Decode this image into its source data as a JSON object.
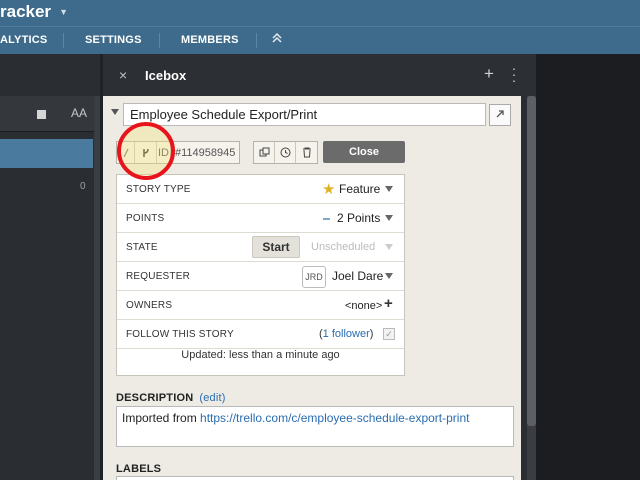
{
  "header": {
    "app_name": "racker",
    "nav": [
      {
        "label": "ALYTICS"
      },
      {
        "label": "SETTINGS"
      },
      {
        "label": "MEMBERS"
      }
    ],
    "collapse_icon": "double-chevron-up-icon"
  },
  "left_panel": {
    "zero_count": "0",
    "font_size_label": "AA"
  },
  "panel": {
    "title": "Icebox",
    "close_glyph": "×",
    "add_glyph": "+"
  },
  "story": {
    "title": "Employee Schedule Export/Print",
    "id_label": "ID",
    "id_value": "#114958945",
    "close_label": "Close",
    "fields": {
      "story_type": {
        "label": "STORY TYPE",
        "value": "Feature"
      },
      "points": {
        "label": "POINTS",
        "value": "2 Points"
      },
      "state": {
        "label": "STATE",
        "start": "Start",
        "value": "Unscheduled"
      },
      "requester": {
        "label": "REQUESTER",
        "initials": "JRD",
        "value": "Joel Dare"
      },
      "owners": {
        "label": "OWNERS",
        "value": "<none>"
      },
      "follow": {
        "label": "FOLLOW THIS STORY",
        "open": "(",
        "link": "1 follower",
        "close": ")"
      }
    },
    "updated": "Updated: less than a minute ago",
    "description": {
      "heading": "DESCRIPTION",
      "edit": "(edit)",
      "prefix": "Imported from ",
      "url": "https://trello.com/c/employee-schedule-export-print"
    },
    "labels_heading": "LABELS"
  },
  "colors": {
    "header_bg": "#3e6b8c",
    "highlight_ring": "#e8131b",
    "link": "#2a6db0",
    "star": "#e2b226"
  }
}
